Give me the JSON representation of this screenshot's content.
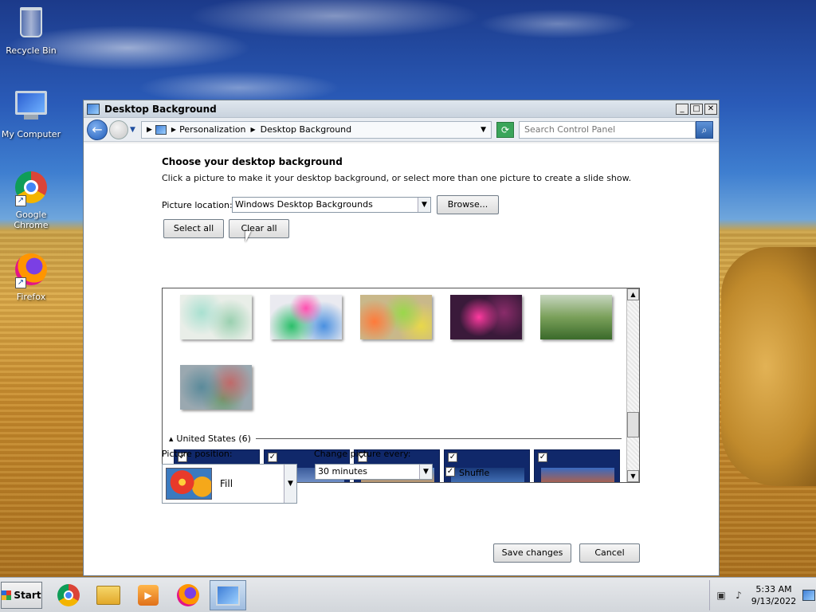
{
  "desktop": {
    "icons": [
      {
        "label": "Recycle Bin",
        "icon": "recycle-bin-icon"
      },
      {
        "label": "My Computer",
        "icon": "computer-icon"
      },
      {
        "label": "Google Chrome",
        "icon": "chrome-icon"
      },
      {
        "label": "Firefox",
        "icon": "firefox-icon"
      }
    ]
  },
  "window": {
    "title": "Desktop Background",
    "controls": {
      "minimize": "_",
      "maximize": "□",
      "close": "✕"
    },
    "address": {
      "crumbs": [
        "Personalization",
        "Desktop Background"
      ],
      "search_placeholder": "Search Control Panel"
    },
    "heading": "Choose your desktop background",
    "subtext": "Click a picture to make it your desktop background, or select more than one picture to create a slide show.",
    "picture_location": {
      "label": "Picture location:",
      "value": "Windows Desktop Backgrounds",
      "browse": "Browse..."
    },
    "select_all": "Select all",
    "clear_all": "Clear all",
    "gallery": {
      "group_label": "United States (6)",
      "group_checked": [
        true,
        true,
        true,
        true,
        true
      ]
    },
    "picture_position": {
      "label": "Picture position:",
      "value": "Fill"
    },
    "change_every": {
      "label": "Change picture every:",
      "value": "30 minutes"
    },
    "shuffle": {
      "label": "Shuffle",
      "checked": true
    },
    "save": "Save changes",
    "cancel": "Cancel"
  },
  "taskbar": {
    "start": "Start",
    "items": [
      "chrome-icon",
      "file-explorer-icon",
      "media-player-icon",
      "firefox-icon",
      "control-panel-icon"
    ],
    "active_item": "control-panel-icon",
    "clock": {
      "time": "5:33 AM",
      "date": "9/13/2022"
    }
  }
}
